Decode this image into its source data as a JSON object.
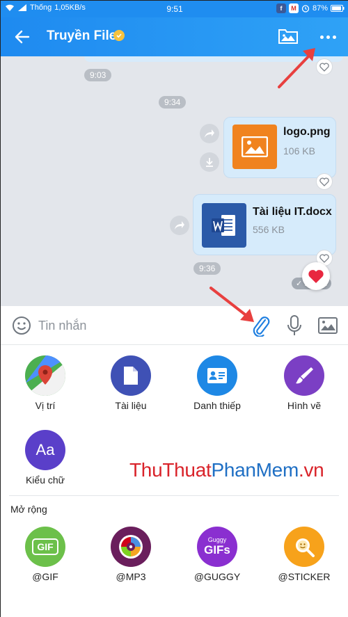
{
  "status_bar": {
    "carrier": "Thống",
    "speed": "1,05KB/s",
    "time": "9:51",
    "battery": "87%"
  },
  "header": {
    "title": "Truyền File"
  },
  "chat": {
    "time_1": "9:03",
    "time_2": "9:34",
    "time_3": "9:36",
    "file_1": {
      "name": "logo.png",
      "size": "106 KB"
    },
    "file_2": {
      "name": "Tài liệu IT.docx",
      "size": "556 KB"
    },
    "sent_status": "✓ Đã gửi"
  },
  "input": {
    "placeholder": "Tin nhắn"
  },
  "panel": {
    "items": [
      {
        "label": "Vị trí"
      },
      {
        "label": "Tài liệu"
      },
      {
        "label": "Danh thiếp"
      },
      {
        "label": "Hình vẽ"
      },
      {
        "label": "Kiểu chữ",
        "glyph": "Aa"
      }
    ],
    "section_title": "Mở rộng",
    "extensions": [
      {
        "label": "@GIF",
        "glyph": "GIF"
      },
      {
        "label": "@MP3"
      },
      {
        "label": "@GUGGY",
        "glyph_small": "Guggy",
        "glyph": "GIFs"
      },
      {
        "label": "@STICKER"
      }
    ],
    "watermark_red": "ThuThuat",
    "watermark_blue": "PhanMem",
    "watermark_suffix": ".vn"
  },
  "colors": {
    "accent": "#1f8df0",
    "bubble": "#d6ebfb",
    "annotation_arrow": "#e8403f"
  }
}
